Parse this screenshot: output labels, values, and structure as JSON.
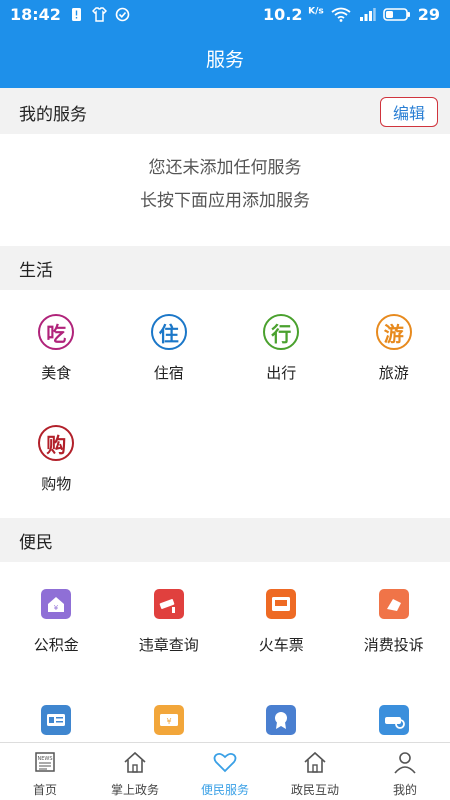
{
  "status_bar": {
    "time": "18:42",
    "speed": "10.2",
    "speed_unit": "K/s",
    "battery": "29"
  },
  "header": {
    "title": "服务"
  },
  "my_services": {
    "title": "我的服务",
    "edit_label": "编辑",
    "empty_line1": "您还未添加任何服务",
    "empty_line2": "长按下面应用添加服务"
  },
  "life": {
    "title": "生活",
    "items": [
      {
        "label": "美食",
        "glyph": "吃",
        "icon": "food-icon",
        "color": "#b0237a"
      },
      {
        "label": "住宿",
        "glyph": "住",
        "icon": "hotel-icon",
        "color": "#1b77c8"
      },
      {
        "label": "出行",
        "glyph": "行",
        "icon": "travel-icon",
        "color": "#4aa12e"
      },
      {
        "label": "旅游",
        "glyph": "游",
        "icon": "tourism-icon",
        "color": "#e78a1e"
      },
      {
        "label": "购物",
        "glyph": "购",
        "icon": "shopping-icon",
        "color": "#b2202a"
      }
    ]
  },
  "convenience": {
    "title": "便民",
    "items": [
      {
        "label": "公积金",
        "icon": "housing-fund-icon",
        "color": "#8f6fd6"
      },
      {
        "label": "违章查询",
        "icon": "traffic-violation-icon",
        "color": "#e0403e"
      },
      {
        "label": "火车票",
        "icon": "train-ticket-icon",
        "color": "#ee6a24"
      },
      {
        "label": "消费投诉",
        "icon": "consumer-complaint-icon",
        "color": "#f07448"
      }
    ],
    "more_icons": [
      {
        "icon": "id-card-icon",
        "color": "#3f86cf"
      },
      {
        "icon": "ticket-icon",
        "color": "#f2a63a"
      },
      {
        "icon": "certificate-icon",
        "color": "#4a7fd0"
      },
      {
        "icon": "car-search-icon",
        "color": "#3b8fdc"
      }
    ]
  },
  "tabbar": {
    "tabs": [
      {
        "label": "首页",
        "icon": "news-icon"
      },
      {
        "label": "掌上政务",
        "icon": "home-icon"
      },
      {
        "label": "便民服务",
        "icon": "heart-icon",
        "active": true
      },
      {
        "label": "政民互动",
        "icon": "home-icon"
      },
      {
        "label": "我的",
        "icon": "user-icon"
      }
    ]
  },
  "colors": {
    "primary": "#1e90ea",
    "active_tab": "#3aa0e6",
    "edit_border": "#d0343d"
  }
}
